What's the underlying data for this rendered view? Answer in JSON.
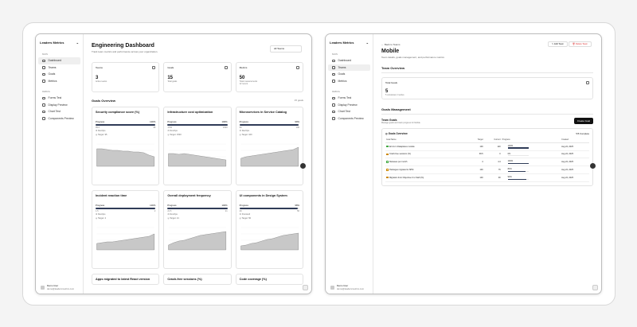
{
  "sidebar": {
    "brand": "Leaders Metrics",
    "section_main": "MAIN",
    "section_debug": "DEBUG",
    "items": [
      "Dashboard",
      "Teams",
      "Goals",
      "Metrics"
    ],
    "debug_items": [
      "Forms Test",
      "Display Preview",
      "Chart Test",
      "Components Preview"
    ],
    "user_name": "Demo User",
    "user_email": "demo@leadersmetrics.com"
  },
  "dashboard": {
    "title": "Engineering Dashboard",
    "subtitle": "Track team metrics and performance across your organization.",
    "team_filter": "All Teams",
    "stats": [
      {
        "label": "Teams",
        "value": "3",
        "sub": "Active teams"
      },
      {
        "label": "Goals",
        "value": "15",
        "sub": "Total goals"
      },
      {
        "label": "Metrics",
        "value": "50",
        "sub": "Total measurements",
        "sub2": "12 recent"
      }
    ],
    "goals_heading": "Goals Overview",
    "goals_count": "15 goals",
    "progress_label": "Progress",
    "goals": [
      {
        "title": "Security compliance score (%)",
        "pct": "100%",
        "p": 1.0,
        "from": "95.0",
        "to": "95",
        "team": "DevOps",
        "target": "Target: 95",
        "pts": [
          22,
          22,
          21,
          20,
          20,
          19,
          19,
          18,
          18,
          17,
          14,
          12
        ]
      },
      {
        "title": "Infrastructure cost optimization",
        "pct": "100%",
        "p": 1.0,
        "from": "1700",
        "to": "1500",
        "team": "DevOps",
        "target": "Target: 1500",
        "pts": [
          16,
          16,
          15,
          16,
          15,
          14,
          13,
          12,
          11,
          10,
          9,
          8
        ]
      },
      {
        "title": "Microservices in Service Catalog",
        "pct": "99%",
        "p": 0.99,
        "from": "99",
        "to": "100",
        "team": "DevOps",
        "target": "Target: 100",
        "pts": [
          10,
          12,
          13,
          14,
          15,
          16,
          17,
          18,
          19,
          20,
          21,
          24
        ]
      },
      {
        "title": "Incident reaction time",
        "pct": "100%",
        "p": 1.0,
        "from": "1.5",
        "to": "2",
        "team": "DevOps",
        "target": "Target: 2",
        "pts": [
          8,
          9,
          10,
          10,
          11,
          12,
          13,
          14,
          15,
          16,
          17,
          20
        ]
      },
      {
        "title": "Overall deployment frequency",
        "pct": "100%",
        "p": 1.0,
        "from": "21.5",
        "to": "21",
        "team": "DevOps",
        "target": "Target: 21",
        "pts": [
          6,
          9,
          11,
          12,
          14,
          16,
          18,
          19,
          20,
          21,
          22,
          23
        ]
      },
      {
        "title": "UI components in Design System",
        "pct": "98%",
        "p": 0.98,
        "from": "49",
        "to": "50",
        "team": "Frontend",
        "target": "Target: 50",
        "pts": [
          5,
          6,
          8,
          9,
          11,
          13,
          14,
          16,
          18,
          19,
          20,
          21
        ]
      },
      {
        "title": "Apps migrated to latest React version"
      },
      {
        "title": "Crash-free sessions (%)"
      },
      {
        "title": "Code coverage (%)"
      }
    ]
  },
  "team": {
    "back": "Back to Teams",
    "name": "Mobile",
    "subtitle": "Team details, goals management, and performance metrics",
    "edit": "Edit Team",
    "delete": "Delete Team",
    "overview": "Team Overview",
    "total_goals_label": "Total Goals",
    "total_goals": "5",
    "total_goals_sub": "5 completed, 0 active",
    "goals_mgmt": "Goals Management",
    "team_goals": "Team Goals",
    "team_goals_sub": "Manage goals and track progress for Mobile",
    "create": "Create Goal",
    "goals_overview": "Goals Overview",
    "completed": "5/5 Complete",
    "cols": [
      "Goal Name",
      "Target",
      "Current",
      "Progress",
      "Created"
    ],
    "rows": [
      {
        "name": "Errors in Dataplanes module",
        "target": "100",
        "current": "120",
        "pct": "100%",
        "p": 1.0,
        "created": "Aug 22, 2025",
        "g": true
      },
      {
        "name": "Crash-free sessions (%)",
        "target": "99.5",
        "current": "0",
        "pct": "0%",
        "p": 0,
        "created": "Aug 22, 2025",
        "g": false
      },
      {
        "name": "Releases per month",
        "target": "4",
        "current": "4.4",
        "pct": "100%",
        "p": 1.0,
        "created": "Aug 22, 2025",
        "g": true
      },
      {
        "name": "Packages migrated to SPM",
        "target": "100",
        "current": "76",
        "pct": "84%",
        "p": 0.84,
        "created": "Aug 22, 2025",
        "g": false
      },
      {
        "name": "Migration from Objective-C to Swift (%)",
        "target": "100",
        "current": "90",
        "pct": "90%",
        "p": 0.9,
        "created": "Aug 22, 2025",
        "g": false
      }
    ]
  }
}
